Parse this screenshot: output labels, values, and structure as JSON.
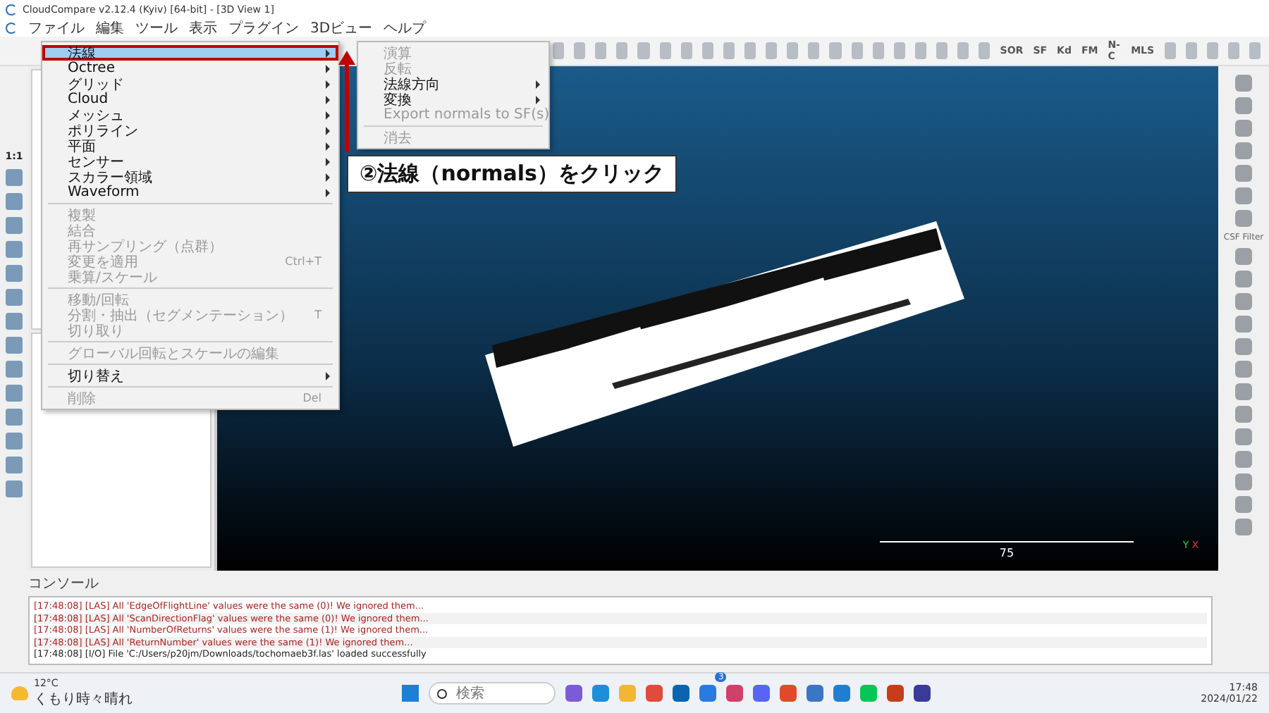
{
  "window": {
    "title": "CloudCompare v2.12.4 (Kyiv) [64-bit] - [3D View 1]"
  },
  "menu_bar": [
    "ファイル",
    "編集",
    "ツール",
    "表示",
    "プラグイン",
    "3Dビュー",
    "ヘルプ"
  ],
  "toolbar": {
    "labels": [
      "SOR",
      "SF",
      "Kd",
      "FM",
      "N-C",
      "MLS"
    ]
  },
  "left_toolbar": {
    "scale_label": "1:1"
  },
  "dropdown": [
    {
      "kind": "item",
      "label": "法線",
      "selected": true,
      "disabled": false,
      "has_submenu": true
    },
    {
      "kind": "item",
      "label": "Octree",
      "selected": false,
      "disabled": false,
      "has_submenu": true
    },
    {
      "kind": "item",
      "label": "グリッド",
      "selected": false,
      "disabled": false,
      "has_submenu": true
    },
    {
      "kind": "item",
      "label": "Cloud",
      "selected": false,
      "disabled": false,
      "has_submenu": true
    },
    {
      "kind": "item",
      "label": "メッシュ",
      "selected": false,
      "disabled": false,
      "has_submenu": true
    },
    {
      "kind": "item",
      "label": "ポリライン",
      "selected": false,
      "disabled": false,
      "has_submenu": true
    },
    {
      "kind": "item",
      "label": "平面",
      "selected": false,
      "disabled": false,
      "has_submenu": true
    },
    {
      "kind": "item",
      "label": "センサー",
      "selected": false,
      "disabled": false,
      "has_submenu": true
    },
    {
      "kind": "item",
      "label": "スカラー領域",
      "selected": false,
      "disabled": false,
      "has_submenu": true
    },
    {
      "kind": "item",
      "label": "Waveform",
      "selected": false,
      "disabled": false,
      "has_submenu": true
    },
    {
      "kind": "separator"
    },
    {
      "kind": "item",
      "label": "複製",
      "selected": false,
      "disabled": true,
      "has_submenu": false
    },
    {
      "kind": "item",
      "label": "結合",
      "selected": false,
      "disabled": true,
      "has_submenu": false
    },
    {
      "kind": "item",
      "label": "再サンプリング（点群）",
      "selected": false,
      "disabled": true,
      "has_submenu": false
    },
    {
      "kind": "item",
      "label": "変更を適用",
      "shortcut": "Ctrl+T",
      "selected": false,
      "disabled": true,
      "has_submenu": false
    },
    {
      "kind": "item",
      "label": "乗算/スケール",
      "selected": false,
      "disabled": true,
      "has_submenu": false
    },
    {
      "kind": "separator"
    },
    {
      "kind": "item",
      "label": "移動/回転",
      "selected": false,
      "disabled": true,
      "has_submenu": false
    },
    {
      "kind": "item",
      "label": "分割・抽出（セグメンテーション）",
      "shortcut": "T",
      "selected": false,
      "disabled": true,
      "has_submenu": false
    },
    {
      "kind": "item",
      "label": "切り取り",
      "selected": false,
      "disabled": true,
      "has_submenu": false
    },
    {
      "kind": "separator"
    },
    {
      "kind": "item",
      "label": "グローバル回転とスケールの編集",
      "selected": false,
      "disabled": true,
      "has_submenu": false
    },
    {
      "kind": "separator"
    },
    {
      "kind": "item",
      "label": "切り替え",
      "selected": false,
      "disabled": false,
      "has_submenu": true
    },
    {
      "kind": "separator"
    },
    {
      "kind": "item",
      "label": "削除",
      "shortcut": "Del",
      "selected": false,
      "disabled": true,
      "has_submenu": false
    }
  ],
  "submenu": [
    {
      "kind": "item",
      "label": "演算",
      "disabled": true,
      "has_submenu": false
    },
    {
      "kind": "item",
      "label": "反転",
      "disabled": true,
      "has_submenu": false
    },
    {
      "kind": "item",
      "label": "法線方向",
      "disabled": false,
      "has_submenu": true
    },
    {
      "kind": "item",
      "label": "変換",
      "disabled": false,
      "has_submenu": true
    },
    {
      "kind": "item",
      "label": "Export normals to SF(s)",
      "disabled": true,
      "has_submenu": false
    },
    {
      "kind": "separator"
    },
    {
      "kind": "item",
      "label": "消去",
      "disabled": true,
      "has_submenu": false
    }
  ],
  "callout": {
    "text": "②法線（normals）をクリック"
  },
  "view": {
    "scale_value": "75",
    "axis_y": "Y",
    "axis_x": "X"
  },
  "right_toolbar": {
    "label": "CSF Filter"
  },
  "console": {
    "title": "コンソール",
    "lines": [
      {
        "kind": "warning",
        "text": "[17:48:08] [LAS] All 'EdgeOfFlightLine' values were the same (0)! We ignored them..."
      },
      {
        "kind": "warning",
        "text": "[17:48:08] [LAS] All 'ScanDirectionFlag' values were the same (0)! We ignored them..."
      },
      {
        "kind": "warning",
        "text": "[17:48:08] [LAS] All 'NumberOfReturns' values were the same (1)! We ignored them..."
      },
      {
        "kind": "warning",
        "text": "[17:48:08] [LAS] All 'ReturnNumber' values were the same (1)! We ignored them..."
      },
      {
        "kind": "info",
        "text": "[17:48:08] [I/O] File 'C:/Users/p20jm/Downloads/tochomaeb3f.las' loaded successfully"
      }
    ]
  },
  "taskbar": {
    "temperature": "12°C",
    "weather": "くもり時々晴れ",
    "search_placeholder": "検索",
    "badge": "3",
    "time": "17:48",
    "date": "2024/01/22"
  }
}
